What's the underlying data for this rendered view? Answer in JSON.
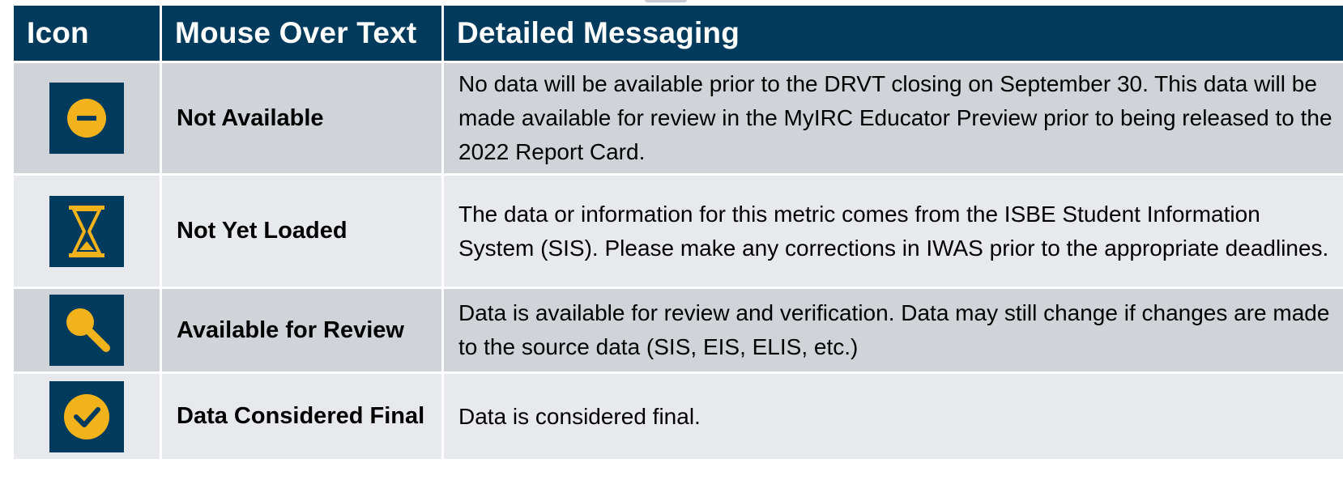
{
  "header": {
    "icon_label": "Icon",
    "mouse_over_label": "Mouse Over Text",
    "detailed_label": "Detailed Messaging"
  },
  "colors": {
    "header_bg": "#003a5c",
    "icon_bg": "#003a5c",
    "icon_accent": "#f2b21b",
    "row_dark": "#d0d3d8",
    "row_light": "#e7e9ec"
  },
  "rows": [
    {
      "icon": "minus-circle-icon",
      "mouse_over": "Not Available",
      "message": "No data will be available prior to the DRVT closing on September 30. This data will be made available for review in the MyIRC Educator Preview prior to being released to the 2022 Report Card."
    },
    {
      "icon": "hourglass-icon",
      "mouse_over": "Not Yet Loaded",
      "message": "The data or information for this metric comes from the ISBE Student Information System (SIS). Please make any corrections in IWAS prior to the appropriate deadlines."
    },
    {
      "icon": "magnifier-icon",
      "mouse_over": "Available for Review",
      "message": "Data is available for review and verification. Data may still change if changes are made to the source data (SIS, EIS, ELIS, etc.)"
    },
    {
      "icon": "check-circle-icon",
      "mouse_over": "Data Considered Final",
      "message": "Data is considered final."
    }
  ]
}
